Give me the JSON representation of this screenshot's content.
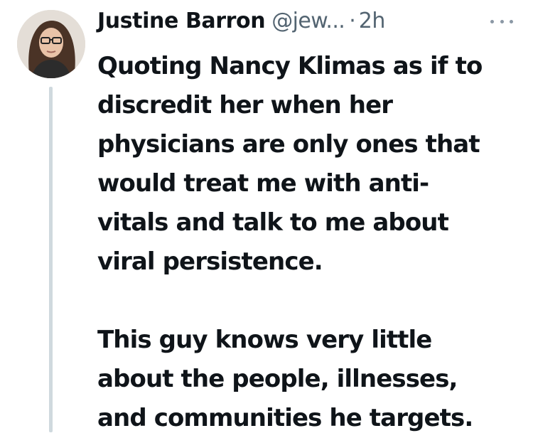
{
  "tweet": {
    "author": {
      "display_name": "Justine Barron",
      "handle": "@jew...",
      "separator": "·",
      "timestamp": "2h"
    },
    "more_icon": "more-horizontal-icon",
    "paragraph1": [
      "Quoting Nancy Klimas as if to",
      "discredit her when her",
      "physicians are only ones that",
      "would treat me with anti-",
      "vitals and talk to me about",
      "viral persistence."
    ],
    "paragraph2": [
      "This guy knows very little",
      "about the people, illnesses,",
      "and communities he targets."
    ]
  },
  "colors": {
    "text": "#0f1419",
    "secondary": "#536471",
    "thread_line": "#cfd9de"
  }
}
